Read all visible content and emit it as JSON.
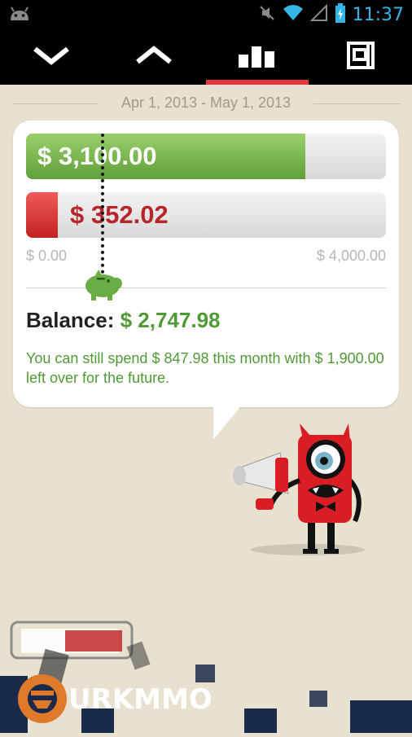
{
  "status_bar": {
    "time": "11:37",
    "icons": [
      "android-icon",
      "muted-icon",
      "wifi-icon",
      "signal-icon",
      "battery-icon"
    ],
    "accent": "#33b5e5"
  },
  "action_bar": {
    "tabs": [
      {
        "icon": "chevron-down-icon",
        "selected": false
      },
      {
        "icon": "chevron-up-icon",
        "selected": false
      },
      {
        "icon": "bar-chart-icon",
        "selected": true
      },
      {
        "icon": "calendar-icon",
        "selected": false
      }
    ],
    "selected_color": "#e23a3a"
  },
  "period": {
    "label": "Apr 1, 2013 - May 1, 2013"
  },
  "summary": {
    "income": {
      "label": "$ 3,100.00",
      "value": 3100.0,
      "color": "#6aad44"
    },
    "spent": {
      "label": "$ 352.02",
      "value": 352.02,
      "color": "#d12a2a"
    },
    "scale_min": {
      "label": "$ 0.00",
      "value": 0
    },
    "scale_max": {
      "label": "$ 4,000.00",
      "value": 4000
    },
    "balance_label": "Balance:",
    "balance_value": "$ 2,747.98",
    "message": "You can still spend $ 847.98 this month with $ 1,900.00 left over for the future.",
    "marker_icon": "piggy-bank-icon",
    "marker_value": 847.98
  },
  "mascot": {
    "name": "monster-with-megaphone"
  },
  "watermark": {
    "text": "URKMMO"
  }
}
